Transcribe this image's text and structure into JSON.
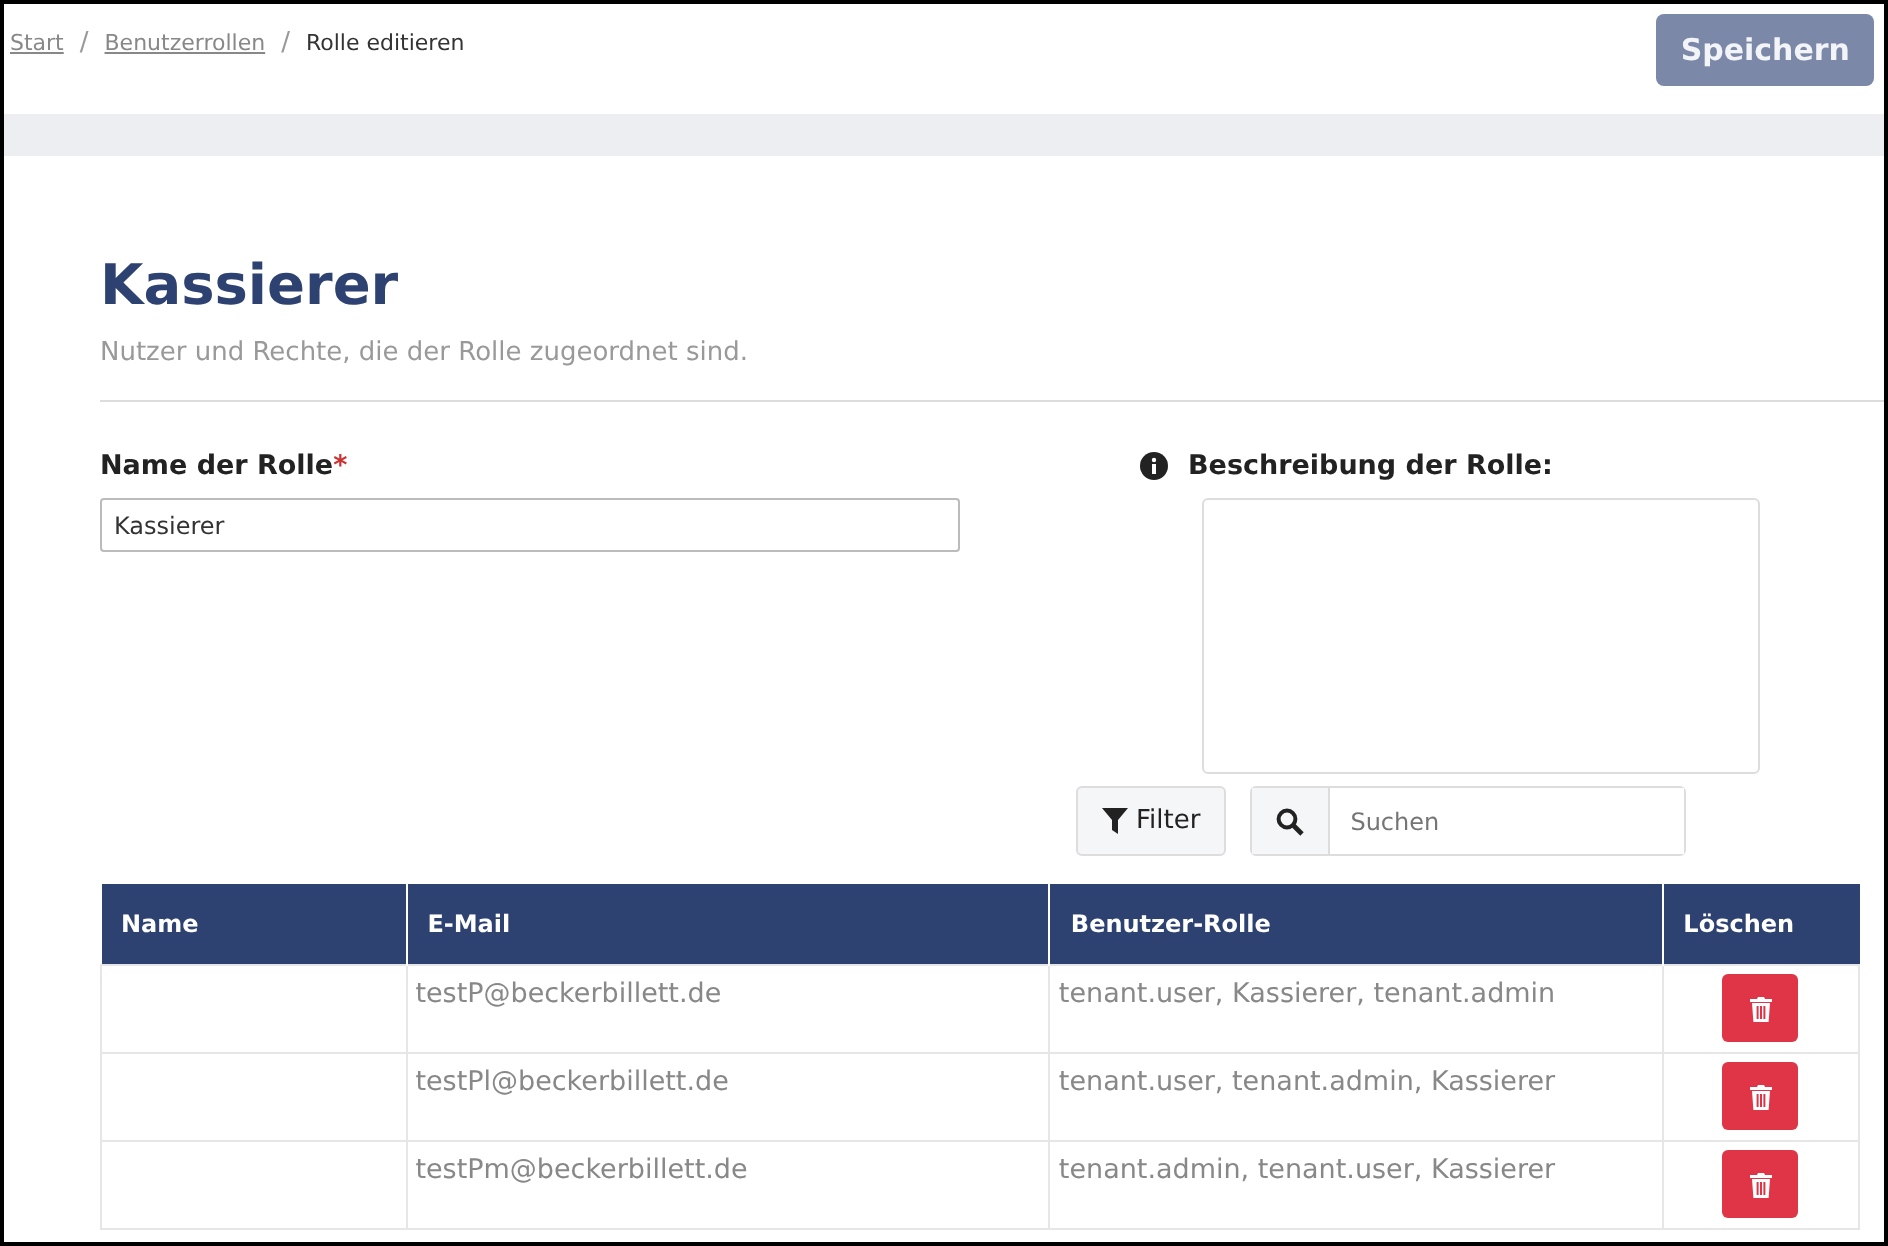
{
  "breadcrumb": [
    {
      "label": "Start",
      "kind": "link"
    },
    {
      "label": "Benutzerrollen",
      "kind": "link"
    },
    {
      "label": "Rolle editieren",
      "kind": "current"
    }
  ],
  "separator": "/",
  "save_button": "Speichern",
  "title": "Kassierer",
  "subtitle": "Nutzer und Rechte, die der Rolle zugeordnet sind.",
  "name_field": {
    "label": "Name der Rolle",
    "required_mark": "*",
    "value": "Kassierer"
  },
  "description_field": {
    "label": "Beschreibung der Rolle:"
  },
  "filter_button": "Filter",
  "search": {
    "placeholder": "Suchen"
  },
  "table": {
    "columns": [
      "Name",
      "E-Mail",
      "Benutzer-Rolle",
      "Löschen"
    ],
    "rows": [
      {
        "email": "testP@beckerbillett.de",
        "roles": "tenant.user, Kassierer, tenant.admin"
      },
      {
        "email": "testPl@beckerbillett.de",
        "roles": "tenant.user, tenant.admin, Kassierer"
      },
      {
        "email": "testPm@beckerbillett.de",
        "roles": "tenant.admin, tenant.user, Kassierer"
      }
    ]
  }
}
